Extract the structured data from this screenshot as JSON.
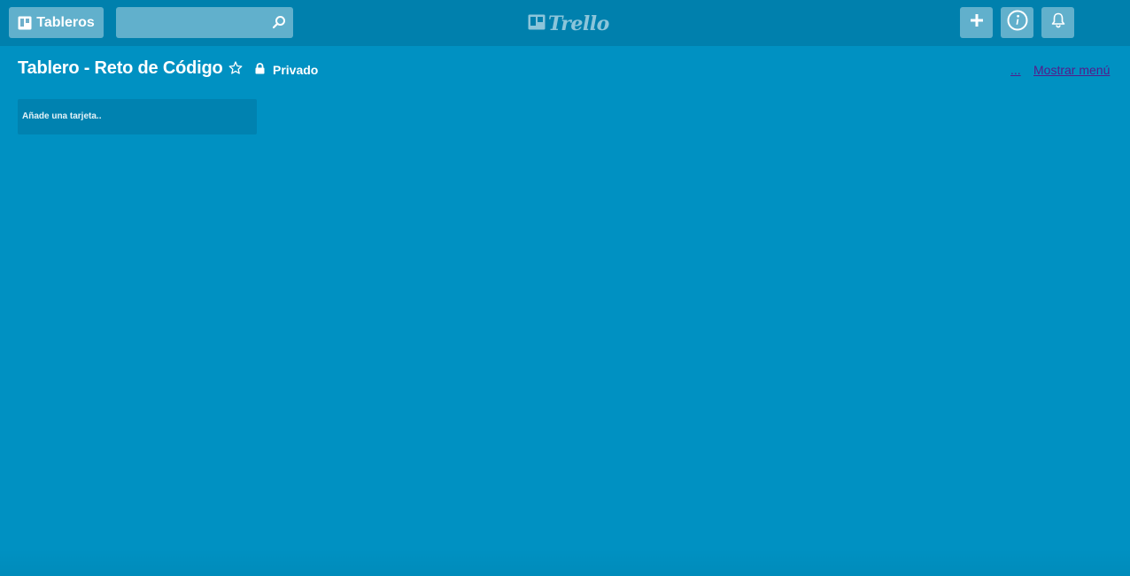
{
  "topbar": {
    "boards_label": "Tableros",
    "search": {
      "value": "",
      "placeholder": ""
    },
    "logo_text": "Trello",
    "icons": [
      "board-icon",
      "search-icon",
      "plus-icon",
      "info-icon",
      "bell-icon"
    ]
  },
  "board": {
    "title": "Tablero - Reto de Código",
    "privacy_label": "Privado",
    "more_label": "...",
    "menu_label": "Mostrar menú",
    "icons": [
      "star-icon",
      "lock-icon"
    ]
  },
  "lists": {
    "add_card_placeholder": "Añade una tarjeta.."
  },
  "colors": {
    "background": "#0091c2",
    "topbar": "#0080ad",
    "link": "#551a8b"
  }
}
